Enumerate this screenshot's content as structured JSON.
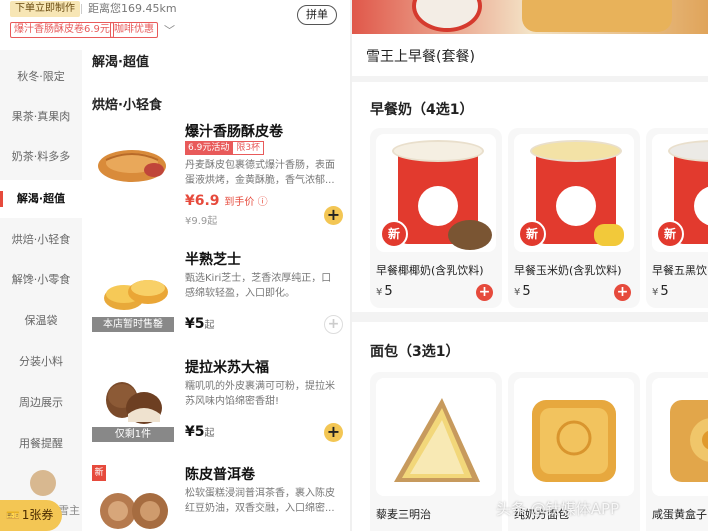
{
  "header": {
    "order_tag": "下单立即制作",
    "distance": "距离您169.45km",
    "pindan": "拼单",
    "coupons": [
      "爆汁香肠酥皮卷6.9元",
      "咖啡优惠"
    ]
  },
  "sidebar": {
    "items": [
      {
        "label": "秋冬·限定"
      },
      {
        "label": "果茶·真果肉"
      },
      {
        "label": "奶茶·料多多"
      },
      {
        "label": "解渴·超值",
        "active": true
      },
      {
        "label": "烘焙·小轻食"
      },
      {
        "label": "解馋·小零食"
      },
      {
        "label": "保温袋"
      },
      {
        "label": "分装小料"
      },
      {
        "label": "周边展示"
      },
      {
        "label": "用餐提醒"
      }
    ],
    "mascot_text": "雪主",
    "coupon_button": "1张券"
  },
  "sections": [
    "解渴·超值",
    "烘焙·小轻食"
  ],
  "products": [
    {
      "name": "爆汁香肠酥皮卷",
      "promo_a": "6.9元活动",
      "promo_b": "限3杯",
      "desc": "丹麦酥皮包裹德式爆汁香肠，表面蛋液烘烤，金黄酥脆，香气浓郁...",
      "price": "¥6.9",
      "price_note": "到手价",
      "original": "¥9.9起"
    },
    {
      "name": "半熟芝士",
      "desc": "甄选Kiri芝士，芝香浓厚纯正，口感绵软轻盈，入口即化。",
      "price": "¥5",
      "price_suffix": "起",
      "badge": "本店暂时售罄"
    },
    {
      "name": "提拉米苏大福",
      "desc": "糯叽叽的外皮裹满可可粉，提拉米苏风味内馅绵密香甜!",
      "price": "¥5",
      "price_suffix": "起",
      "badge": "仅剩1件"
    },
    {
      "name": "陈皮普洱卷",
      "desc": "松软蛋糕浸润普洱茶香，裹入陈皮红豆奶油，双香交融，入口绵密...",
      "new_tag": "新"
    }
  ],
  "right": {
    "meal_title": "雪王上早餐(套餐)",
    "groups": [
      {
        "title": "早餐奶（4选1）",
        "cards": [
          {
            "name": "早餐椰椰奶(含乳饮料)",
            "currency": "¥",
            "price": "5",
            "new": "新"
          },
          {
            "name": "早餐玉米奶(含乳饮料)",
            "currency": "¥",
            "price": "5",
            "new": "新"
          },
          {
            "name": "早餐五黑饮(含乳饮料)",
            "currency": "¥",
            "price": "5",
            "new": "新"
          }
        ]
      },
      {
        "title": "面包（3选1）",
        "cards": [
          {
            "name": "藜麦三明治"
          },
          {
            "name": "纯奶方面包"
          },
          {
            "name": "咸蛋黄盒子"
          }
        ]
      }
    ],
    "watermark": "头条 @钛媒体APP"
  },
  "colors": {
    "accent_red": "#e64a3c",
    "accent_yellow": "#f3c654"
  }
}
